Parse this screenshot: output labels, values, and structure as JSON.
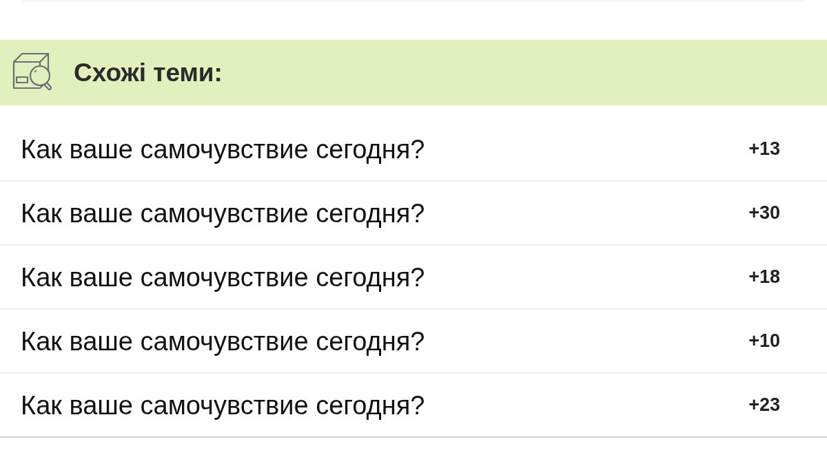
{
  "section": {
    "title": "Схожі теми:"
  },
  "topics": [
    {
      "title": "Как ваше самочувствие сегодня?",
      "count": "+13"
    },
    {
      "title": "Как ваше самочувствие сегодня?",
      "count": "+30"
    },
    {
      "title": "Как ваше самочувствие сегодня?",
      "count": "+18"
    },
    {
      "title": "Как ваше самочувствие сегодня?",
      "count": "+10"
    },
    {
      "title": "Как ваше самочувствие сегодня?",
      "count": "+23"
    }
  ]
}
